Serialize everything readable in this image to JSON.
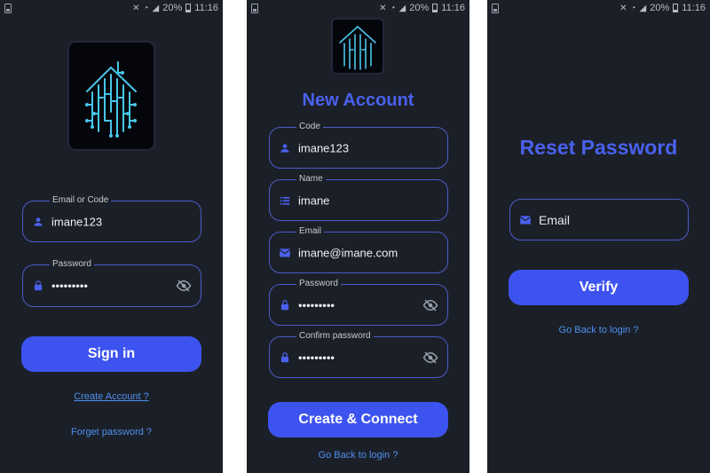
{
  "status_bar": {
    "battery": "20%",
    "time": "11:16"
  },
  "login": {
    "email_field": {
      "label": "Email or Code",
      "value": "imane123"
    },
    "password_field": {
      "label": "Password",
      "value": "•••••••••"
    },
    "sign_in_label": "Sign in",
    "create_account_link": "Create Account ?",
    "forgot_password_link": "Forget password ?"
  },
  "new_account": {
    "title": "New Account",
    "code_field": {
      "label": "Code",
      "value": "imane123"
    },
    "name_field": {
      "label": "Name",
      "value": "imane"
    },
    "email_field": {
      "label": "Email",
      "value": "imane@imane.com"
    },
    "password_field": {
      "label": "Password",
      "value": "•••••••••"
    },
    "confirm_field": {
      "label": "Confirm password",
      "value": "•••••••••"
    },
    "create_label": "Create & Connect",
    "back_link": "Go Back to login ?"
  },
  "reset": {
    "title": "Reset Password",
    "email_field": {
      "placeholder": "Email"
    },
    "verify_label": "Verify",
    "back_link": "Go Back to login ?"
  },
  "colors": {
    "background": "#1b2028",
    "accent": "#3d53f0",
    "title": "#4a61ee",
    "link": "#4f8ff0",
    "field_border": "#4c5bc7"
  },
  "icons": [
    "person-icon",
    "lock-icon",
    "eye-off-icon",
    "list-icon",
    "mail-icon",
    "circuit-house-logo"
  ]
}
